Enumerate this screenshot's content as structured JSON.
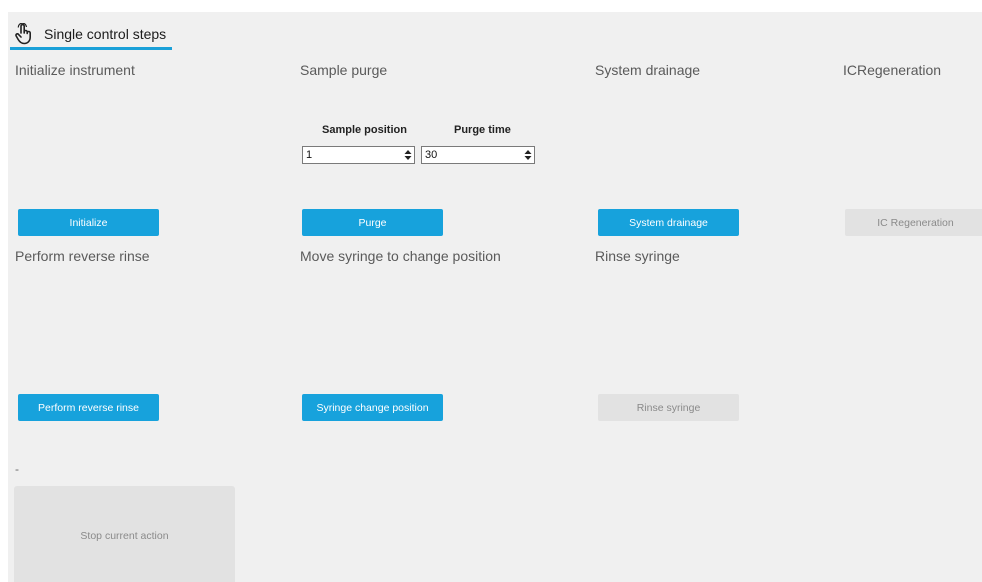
{
  "tab": {
    "label": "Single control steps",
    "icon": "hand-pointer-icon"
  },
  "sections": {
    "initialize": {
      "title": "Initialize instrument",
      "button": "Initialize"
    },
    "sample_purge": {
      "title": "Sample purge",
      "sample_position_label": "Sample position",
      "sample_position_value": "1",
      "purge_time_label": "Purge time",
      "purge_time_value": "30",
      "button": "Purge"
    },
    "system_drainage": {
      "title": "System drainage",
      "button": "System drainage"
    },
    "ic_regeneration": {
      "title": "ICRegeneration",
      "button": "IC Regeneration"
    },
    "reverse_rinse": {
      "title": "Perform reverse rinse",
      "button": "Perform reverse rinse"
    },
    "move_syringe": {
      "title": "Move syringe to change position",
      "button": "Syringe change position"
    },
    "rinse_syringe": {
      "title": "Rinse syringe",
      "button": "Rinse syringe"
    }
  },
  "dash": "-",
  "stop_button": "Stop current action",
  "colors": {
    "accent": "#17a2dc",
    "panel_bg": "#f0f0f0",
    "disabled_bg": "#e2e2e2"
  }
}
